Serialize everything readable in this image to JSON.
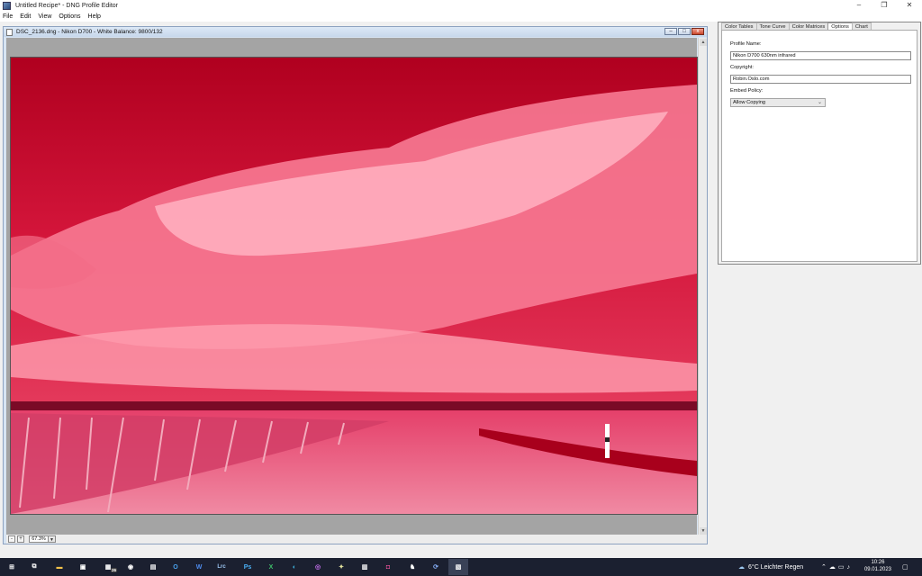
{
  "window": {
    "title": "Untitled Recipe* - DNG Profile Editor",
    "controls": [
      "–",
      "❐",
      "✕"
    ]
  },
  "menu": [
    "File",
    "Edit",
    "View",
    "Options",
    "Help"
  ],
  "image_window": {
    "title": "DSC_2136.dng  - Nikon D700 - White Balance: 9800/132",
    "zoom": "67.3%",
    "photo": {
      "sky_color": "#c8062c",
      "cloud_color": "#ff9fb0",
      "ground_color": "#e85a7c",
      "road_color": "#a8001c"
    }
  },
  "panel": {
    "tabs": [
      "Color Tables",
      "Tone Curve",
      "Color Matrices",
      "Options",
      "Chart"
    ],
    "active_tab": "Options",
    "profile_name_label": "Profile Name:",
    "profile_name_value": "Nikon D700 630nm infrared",
    "copyright_label": "Copyright:",
    "copyright_value": "Robin.Oslo.com",
    "embed_policy_label": "Embed Policy:",
    "embed_policy_value": "Allow Copying"
  },
  "taskbar": {
    "apps": [
      {
        "name": "windows-start-icon",
        "glyph": "⊞"
      },
      {
        "name": "task-view-icon",
        "glyph": "⧉"
      },
      {
        "name": "file-explorer-icon",
        "glyph": "▬"
      },
      {
        "name": "store-icon",
        "glyph": "▣"
      },
      {
        "name": "calendar-icon",
        "glyph": "▦",
        "badge": "26"
      },
      {
        "name": "app-icon-1",
        "glyph": "◉"
      },
      {
        "name": "calculator-icon",
        "glyph": "▤"
      },
      {
        "name": "outlook-icon",
        "glyph": "O"
      },
      {
        "name": "word-icon",
        "glyph": "W"
      },
      {
        "name": "lightroom-classic-icon",
        "glyph": "Lrc"
      },
      {
        "name": "photoshop-icon",
        "glyph": "Ps"
      },
      {
        "name": "excel-icon",
        "glyph": "X"
      },
      {
        "name": "edge-icon",
        "glyph": "◐"
      },
      {
        "name": "messenger-icon",
        "glyph": "◎"
      },
      {
        "name": "app-icon-2",
        "glyph": "✦"
      },
      {
        "name": "app-icon-3",
        "glyph": "▥"
      },
      {
        "name": "instagram-icon",
        "glyph": "◘"
      },
      {
        "name": "app-icon-4",
        "glyph": "♞"
      },
      {
        "name": "app-icon-5",
        "glyph": "⟳"
      },
      {
        "name": "dng-profile-editor-icon",
        "glyph": "▧"
      }
    ],
    "weather": "6°C  Leichter Regen",
    "time": "10:26",
    "date": "09.01.2023"
  }
}
